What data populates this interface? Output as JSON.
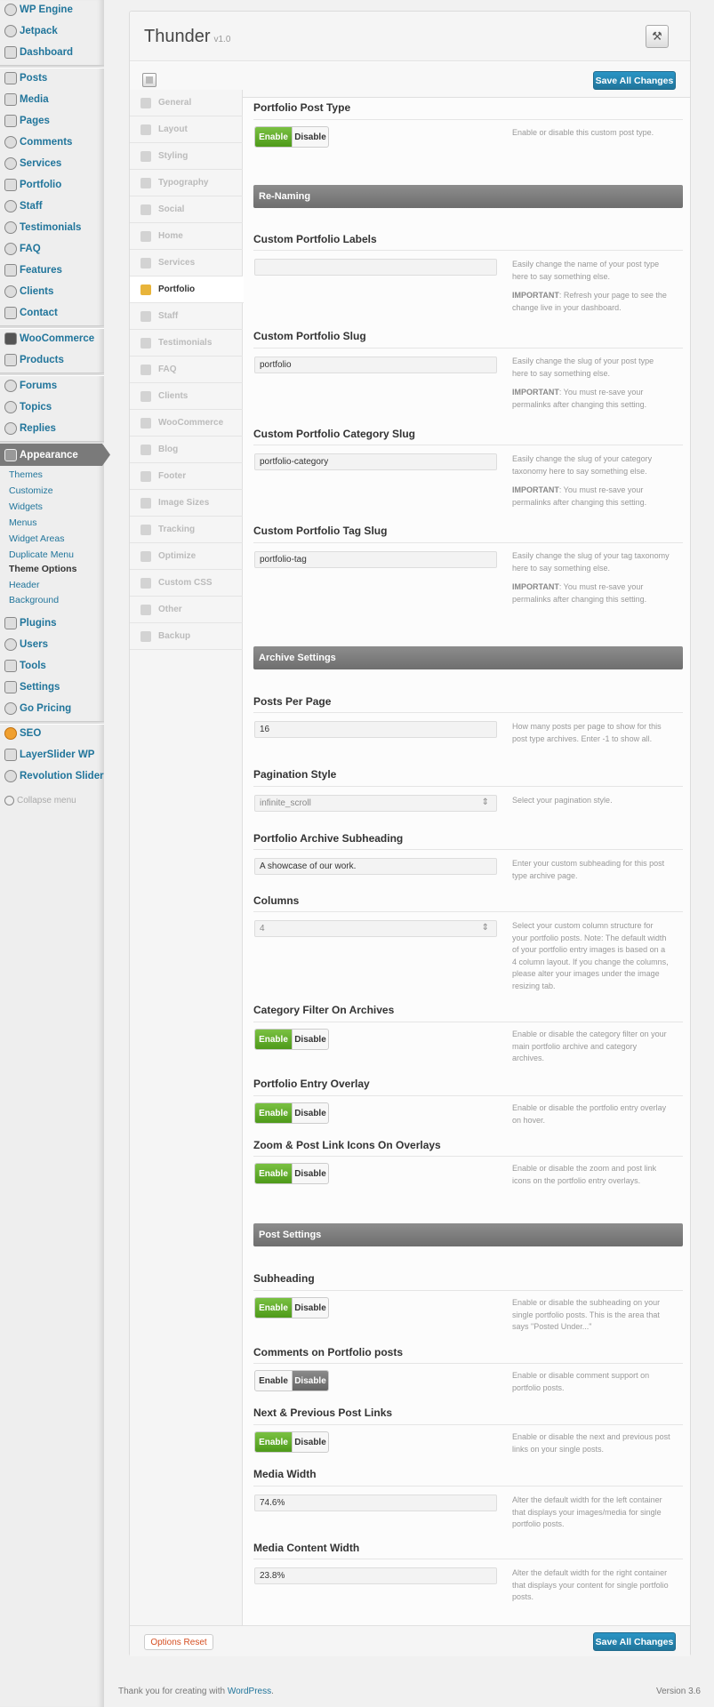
{
  "admin_menu": {
    "group1": [
      "WP Engine",
      "Jetpack",
      "Dashboard"
    ],
    "group2": [
      "Posts",
      "Media",
      "Pages",
      "Comments",
      "Services",
      "Portfolio",
      "Staff",
      "Testimonials",
      "FAQ",
      "Features",
      "Clients",
      "Contact"
    ],
    "group3": [
      "WooCommerce",
      "Products"
    ],
    "group4": [
      "Forums",
      "Topics",
      "Replies"
    ],
    "appearance": "Appearance",
    "appearance_sub": [
      "Themes",
      "Customize",
      "Widgets",
      "Menus",
      "Widget Areas",
      "Duplicate Menu",
      "Theme Options",
      "Header",
      "Background"
    ],
    "group5": [
      "Plugins",
      "Users",
      "Tools",
      "Settings",
      "Go Pricing"
    ],
    "group6": [
      "SEO",
      "LayerSlider WP",
      "Revolution Slider"
    ],
    "collapse": "Collapse menu"
  },
  "header": {
    "title": "Thunder",
    "version": "v1.0",
    "save_label": "Save All Changes",
    "icon": "tools-icon"
  },
  "tabs": [
    "General",
    "Layout",
    "Styling",
    "Typography",
    "Social",
    "Home",
    "Services",
    "Portfolio",
    "Staff",
    "Testimonials",
    "FAQ",
    "Clients",
    "WooCommerce",
    "Blog",
    "Footer",
    "Image Sizes",
    "Tracking",
    "Optimize",
    "Custom CSS",
    "Other",
    "Backup"
  ],
  "active_tab": "Portfolio",
  "toggle_labels": {
    "enable": "Enable",
    "disable": "Disable"
  },
  "sections": {
    "post_type": {
      "heading": "Portfolio Post Type",
      "state": "enable",
      "desc": "Enable or disable this custom post type."
    },
    "renaming": "Re-Naming",
    "labels": {
      "heading": "Custom Portfolio Labels",
      "value": "",
      "desc1": "Easily change the name of your post type here to say something else.",
      "desc2_bold": "IMPORTANT",
      "desc2": ": Refresh your page to see the change live in your dashboard."
    },
    "slug": {
      "heading": "Custom Portfolio Slug",
      "value": "portfolio",
      "desc1": "Easily change the slug of your post type here to say something else.",
      "desc2_bold": "IMPORTANT",
      "desc2": ": You must re-save your permalinks after changing this setting."
    },
    "cat_slug": {
      "heading": "Custom Portfolio Category Slug",
      "value": "portfolio-category",
      "desc1": "Easily change the slug of your category taxonomy here to say something else.",
      "desc2_bold": "IMPORTANT",
      "desc2": ": You must re-save your permalinks after changing this setting."
    },
    "tag_slug": {
      "heading": "Custom Portfolio Tag Slug",
      "value": "portfolio-tag",
      "desc1": "Easily change the slug of your tag taxonomy here to say something else.",
      "desc2_bold": "IMPORTANT",
      "desc2": ": You must re-save your permalinks after changing this setting."
    },
    "archive": "Archive Settings",
    "ppp": {
      "heading": "Posts Per Page",
      "value": "16",
      "desc": "How many posts per page to show for this post type archives. Enter -1 to show all."
    },
    "pagination": {
      "heading": "Pagination Style",
      "value": "infinite_scroll",
      "desc": "Select your pagination style."
    },
    "subheading": {
      "heading": "Portfolio Archive Subheading",
      "value": "A showcase of our work.",
      "desc": "Enter your custom subheading for this post type archive page."
    },
    "columns": {
      "heading": "Columns",
      "value": "4",
      "desc": "Select your custom column structure for your portfolio posts. Note: The default width of your portfolio entry images is based on a 4 column layout. If you change the columns, please alter your images under the image resizing tab."
    },
    "cat_filter": {
      "heading": "Category Filter On Archives",
      "state": "enable",
      "desc": "Enable or disable the category filter on your main portfolio archive and category archives."
    },
    "overlay": {
      "heading": "Portfolio Entry Overlay",
      "state": "enable",
      "desc": "Enable or disable the portfolio entry overlay on hover."
    },
    "zoom": {
      "heading": "Zoom & Post Link Icons On Overlays",
      "state": "enable",
      "desc": "Enable or disable the zoom and post link icons on the portfolio entry overlays."
    },
    "post": "Post Settings",
    "sub_toggle": {
      "heading": "Subheading",
      "state": "enable",
      "desc": "Enable or disable the subheading on your single portfolio posts. This is the area that says \"Posted Under...\""
    },
    "comments": {
      "heading": "Comments on Portfolio posts",
      "state": "disable",
      "desc": "Enable or disable comment support on portfolio posts."
    },
    "nextprev": {
      "heading": "Next & Previous Post Links",
      "state": "enable",
      "desc": "Enable or disable the next and previous post links on your single posts."
    },
    "media_width": {
      "heading": "Media Width",
      "value": "74.6%",
      "desc": "Alter the default width for the left container that displays your images/media for single portfolio posts."
    },
    "media_content": {
      "heading": "Media Content Width",
      "value": "23.8%",
      "desc": "Alter the default width for the right container that displays your content for single portfolio posts."
    }
  },
  "footer_bar": {
    "reset": "Options Reset",
    "save": "Save All Changes"
  },
  "wp_footer": {
    "text": "Thank you for creating with ",
    "link": "WordPress",
    "period": ".",
    "version": "Version 3.6"
  }
}
